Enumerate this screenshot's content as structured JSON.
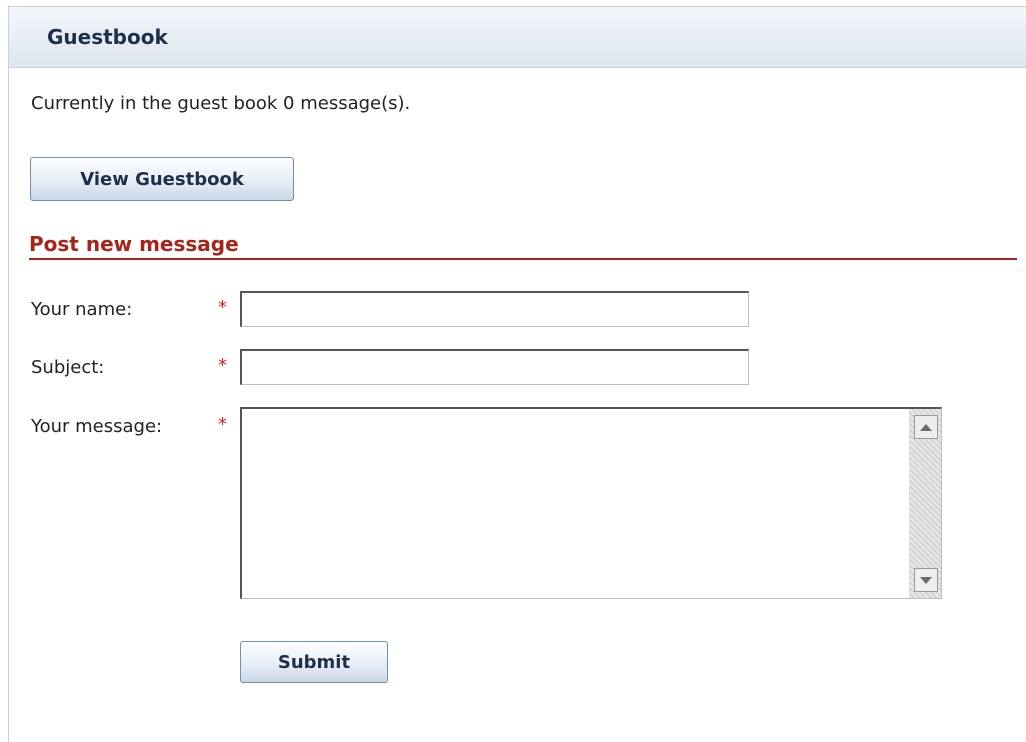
{
  "header": {
    "title": "Guestbook"
  },
  "status": {
    "message_count_text": "Currently in the guest book 0 message(s)."
  },
  "actions": {
    "view_label": "View Guestbook"
  },
  "form": {
    "section_title": "Post new message",
    "required_marker": "*",
    "name_label": "Your name:",
    "name_value": "",
    "subject_label": "Subject:",
    "subject_value": "",
    "message_label": "Your message:",
    "message_value": "",
    "submit_label": "Submit"
  },
  "colors": {
    "header_bg": "#dde5ef",
    "section_title": "#a8231a",
    "required_marker": "#e02020"
  },
  "icons": {
    "scroll_up": "arrow-up-icon",
    "scroll_down": "arrow-down-icon"
  }
}
